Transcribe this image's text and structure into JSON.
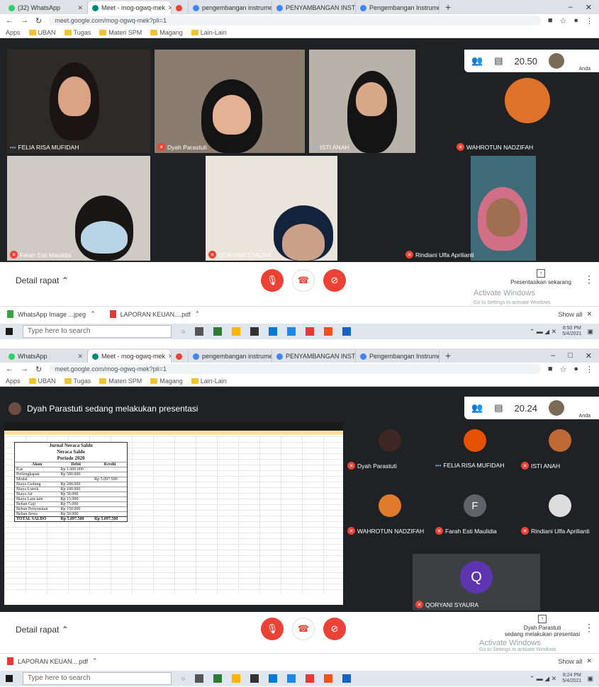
{
  "shotA": {
    "tabs": [
      "(32) WhatsApp",
      "Meet - mog-ogwq-mek",
      "",
      "pengembangan instrumen pe",
      "PENYAMBANGAN INSTRUMEN",
      "Pengembangan Instrumen Te"
    ],
    "url": "meet.google.com/mog-ogwq-mek?pli=1",
    "bookmarks": [
      "Apps",
      "UBAN",
      "Tugas",
      "Materi SPM",
      "Magang",
      "Lain-Lain"
    ],
    "meeting_time": "20.50",
    "avatar_label": "Anda",
    "participants": [
      "FELIA RISA MUFIDAH",
      "Dyah Parastuti",
      "ISTI ANAH",
      "WAHROTUN NADZIFAH",
      "Farah Esti Maulidia",
      "QORYANI SYAURA",
      "Rindiani Ulfa Aprilianti"
    ],
    "detail_label": "Detail rapat",
    "present_label": "Presentasikan sekarang",
    "watermark": [
      "Activate Windows",
      "Go to Settings to activate Windows."
    ],
    "downloads": [
      "WhatsApp Image ...jpeg",
      "LAPORAN KEUAN....pdf"
    ],
    "show_all": "Show all",
    "search_placeholder": "Type here to search",
    "clock": [
      "8:50 PM",
      "5/4/2021"
    ]
  },
  "shotB": {
    "tabs": [
      "WhatsApp",
      "Meet - mog-ogwq-mek",
      "",
      "pengembangan instrumen pe",
      "PENYAMBANGAN INSTRUMEN",
      "Pengembangan Instrumen Te"
    ],
    "url": "meet.google.com/mog-ogwq-mek?pli=1",
    "bookmarks": [
      "Apps",
      "UBAN",
      "Tugas",
      "Materi SPM",
      "Magang",
      "Lain-Lain"
    ],
    "banner": "Dyah Parastuti sedang melakukan presentasi",
    "meeting_time": "20.24",
    "avatar_label": "Anda",
    "sheet": {
      "title": [
        "Jurnal Neraca Saldo",
        "Neraca Saldo",
        "Periode 2020"
      ],
      "headers": [
        "Akun",
        "Debit",
        "Kredit"
      ],
      "rows": [
        [
          "Kas",
          "Rp 1.000.000",
          ""
        ],
        [
          "Perlengkapan",
          "Rp 500.000",
          ""
        ],
        [
          "Modal",
          "",
          "Rp 5.097.500"
        ],
        [
          "Biaya Gedung",
          "Rp 200.000",
          ""
        ],
        [
          "Biaya Listrik",
          "Rp 100.000",
          ""
        ],
        [
          "Biaya Air",
          "Rp 50.000",
          ""
        ],
        [
          "Biaya Lain-lain",
          "Rp 15.000",
          ""
        ],
        [
          "Beban Gaji",
          "Rp 75.000",
          ""
        ],
        [
          "Beban Penyusutan",
          "Rp 150.000",
          ""
        ],
        [
          "Beban Sewa",
          "Rp 50.000",
          ""
        ]
      ],
      "total": [
        "TOTAL SALDO",
        "Rp 5.097.500",
        "Rp 5.097.500"
      ]
    },
    "participants": [
      {
        "name": "Dyah Parastuti",
        "initial": "",
        "muted": true
      },
      {
        "name": "FELIA RISA MUFIDAH",
        "initial": "",
        "muted": false
      },
      {
        "name": "ISTI ANAH",
        "initial": "",
        "muted": true
      },
      {
        "name": "WAHROTUN NADZIFAH",
        "initial": "",
        "muted": true
      },
      {
        "name": "Farah Esti Maulidia",
        "initial": "F",
        "muted": true
      },
      {
        "name": "Rindiani Ulfa Aprilianti",
        "initial": "",
        "muted": true
      },
      {
        "name": "QORYANI SYAURA",
        "initial": "Q",
        "muted": true
      }
    ],
    "detail_label": "Detail rapat",
    "present_label": [
      "Dyah Parastuti",
      "sedang melakukan presentasi"
    ],
    "watermark": [
      "Activate Windows",
      "Go to Settings to activate Windows."
    ],
    "downloads": [
      "LAPORAN KEUAN....pdf"
    ],
    "show_all": "Show all",
    "search_placeholder": "Type here to search",
    "clock": [
      "8:24 PM",
      "5/4/2021"
    ]
  },
  "colors": {
    "meet_bg": "#202124",
    "mute_red": "#ea4335",
    "farah_avatar": "#5f6368",
    "qory_avatar": "#5e35b1"
  }
}
